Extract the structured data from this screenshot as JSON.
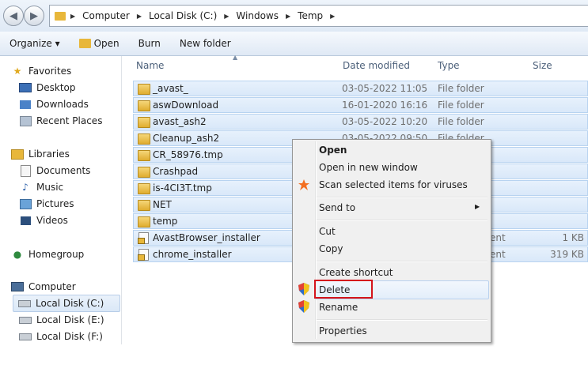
{
  "address_bar": {
    "crumbs": [
      "Computer",
      "Local Disk (C:)",
      "Windows",
      "Temp"
    ]
  },
  "toolbar": {
    "organize": "Organize ▾",
    "open": "Open",
    "burn": "Burn",
    "new_folder": "New folder"
  },
  "nav": {
    "favorites": "Favorites",
    "desktop": "Desktop",
    "downloads": "Downloads",
    "recent": "Recent Places",
    "libraries": "Libraries",
    "documents": "Documents",
    "music": "Music",
    "pictures": "Pictures",
    "videos": "Videos",
    "homegroup": "Homegroup",
    "computer": "Computer",
    "disk_c": "Local Disk (C:)",
    "disk_e": "Local Disk (E:)",
    "disk_f": "Local Disk (F:)"
  },
  "columns": {
    "name": "Name",
    "date": "Date modified",
    "type": "Type",
    "size": "Size"
  },
  "files": [
    {
      "name": "_avast_",
      "date": "03-05-2022 11:05",
      "type": "File folder",
      "size": ""
    },
    {
      "name": "aswDownload",
      "date": "16-01-2020 16:16",
      "type": "File folder",
      "size": ""
    },
    {
      "name": "avast_ash2",
      "date": "03-05-2022 10:20",
      "type": "File folder",
      "size": ""
    },
    {
      "name": "Cleanup_ash2",
      "date": "03-05-2022 09:50",
      "type": "File folder",
      "size": ""
    },
    {
      "name": "CR_58976.tmp",
      "date": "",
      "type": "",
      "size": ""
    },
    {
      "name": "Crashpad",
      "date": "",
      "type": "",
      "size": ""
    },
    {
      "name": "is-4CI3T.tmp",
      "date": "",
      "type": "",
      "size": ""
    },
    {
      "name": "NET",
      "date": "",
      "type": "",
      "size": ""
    },
    {
      "name": "temp",
      "date": "",
      "type": "",
      "size": ""
    },
    {
      "name": "AvastBrowser_installer",
      "date": "",
      "type": "ent",
      "size": "1 KB"
    },
    {
      "name": "chrome_installer",
      "date": "",
      "type": "ent",
      "size": "319 KB"
    }
  ],
  "context_menu": {
    "open": "Open",
    "open_new_window": "Open in new window",
    "scan": "Scan selected items for viruses",
    "send_to": "Send to",
    "cut": "Cut",
    "copy": "Copy",
    "create_shortcut": "Create shortcut",
    "delete": "Delete",
    "rename": "Rename",
    "properties": "Properties"
  },
  "colors": {
    "selection": "#d9e8f9",
    "highlight_box": "#d4141c",
    "avast_orange": "#f36f21",
    "folder": "#e8b73a"
  }
}
